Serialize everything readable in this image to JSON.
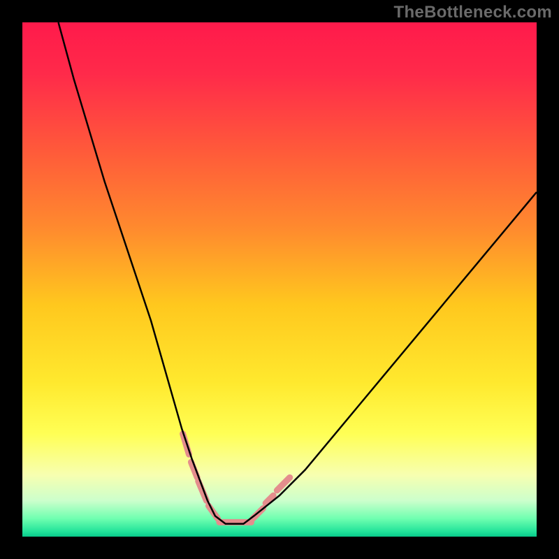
{
  "watermark": "TheBottleneck.com",
  "chart_data": {
    "type": "line",
    "title": "",
    "xlabel": "",
    "ylabel": "",
    "xlim": [
      0,
      100
    ],
    "ylim": [
      0,
      100
    ],
    "legend": false,
    "grid": false,
    "background_gradient_stops": [
      {
        "offset": 0.0,
        "color": "#ff1a4b"
      },
      {
        "offset": 0.1,
        "color": "#ff2a4a"
      },
      {
        "offset": 0.25,
        "color": "#ff5a3a"
      },
      {
        "offset": 0.4,
        "color": "#ff8a2e"
      },
      {
        "offset": 0.55,
        "color": "#ffc81e"
      },
      {
        "offset": 0.7,
        "color": "#ffe92e"
      },
      {
        "offset": 0.8,
        "color": "#ffff55"
      },
      {
        "offset": 0.88,
        "color": "#f7ffb0"
      },
      {
        "offset": 0.93,
        "color": "#ccffcc"
      },
      {
        "offset": 0.965,
        "color": "#6fffb0"
      },
      {
        "offset": 0.99,
        "color": "#22e39a"
      },
      {
        "offset": 1.0,
        "color": "#08c98a"
      }
    ],
    "series": [
      {
        "name": "bottleneck-curve",
        "color": "#000000",
        "stroke_width": 2.5,
        "x": [
          7,
          10,
          13,
          16,
          19,
          22,
          25,
          27,
          29,
          31,
          33,
          34.5,
          36,
          37.5,
          39.5,
          43,
          45,
          50,
          55,
          60,
          65,
          70,
          75,
          80,
          85,
          90,
          95,
          100
        ],
        "y": [
          100,
          89,
          79,
          69,
          60,
          51,
          42,
          35,
          28,
          21,
          15,
          11,
          7,
          4,
          2.5,
          2.5,
          4,
          8,
          13,
          19,
          25,
          31,
          37,
          43,
          49,
          55,
          61,
          67
        ]
      }
    ],
    "highlight_segments": {
      "color": "#e48d8d",
      "stroke_width": 9,
      "linecap": "round",
      "segments": [
        {
          "x": [
            31.2,
            32.4
          ],
          "y": [
            20.0,
            16.0
          ]
        },
        {
          "x": [
            32.8,
            34.0
          ],
          "y": [
            14.5,
            11.5
          ]
        },
        {
          "x": [
            34.2,
            35.8
          ],
          "y": [
            10.8,
            7.0
          ]
        },
        {
          "x": [
            36.2,
            38.0
          ],
          "y": [
            6.0,
            3.5
          ]
        },
        {
          "x": [
            38.3,
            44.5
          ],
          "y": [
            2.8,
            2.8
          ]
        },
        {
          "x": [
            44.8,
            46.8
          ],
          "y": [
            3.5,
            5.5
          ]
        },
        {
          "x": [
            47.3,
            48.8
          ],
          "y": [
            6.5,
            8.0
          ]
        },
        {
          "x": [
            49.5,
            52.0
          ],
          "y": [
            9.0,
            11.5
          ]
        }
      ]
    }
  }
}
